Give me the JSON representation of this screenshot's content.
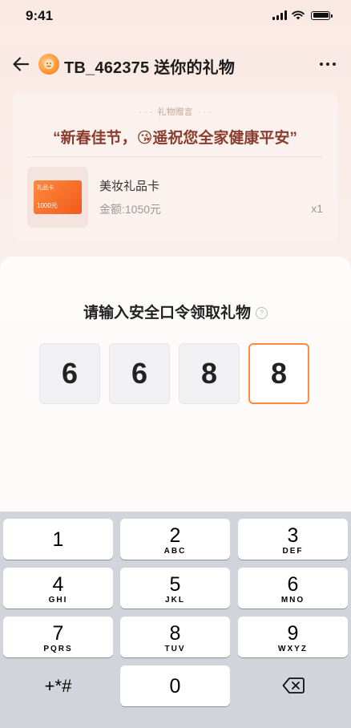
{
  "status": {
    "time": "9:41"
  },
  "header": {
    "title": "TB_462375 送你的礼物"
  },
  "gift": {
    "label": "礼物赠言",
    "message": "“新春佳节，😘遥祝您全家健康平安”",
    "card_label": "礼品卡",
    "card_amount": "1000元",
    "name": "美妆礼品卡",
    "amount": "金额:1050元",
    "qty": "x1"
  },
  "sheet": {
    "prompt": "请输入安全口令领取礼物",
    "help_symbol": "?",
    "code": [
      "6",
      "6",
      "8",
      "8"
    ]
  },
  "keypad": {
    "keys": [
      {
        "num": "1",
        "letters": ""
      },
      {
        "num": "2",
        "letters": "ABC"
      },
      {
        "num": "3",
        "letters": "DEF"
      },
      {
        "num": "4",
        "letters": "GHI"
      },
      {
        "num": "5",
        "letters": "JKL"
      },
      {
        "num": "6",
        "letters": "MNO"
      },
      {
        "num": "7",
        "letters": "PQRS"
      },
      {
        "num": "8",
        "letters": "TUV"
      },
      {
        "num": "9",
        "letters": "WXYZ"
      }
    ],
    "symbols": "+*#",
    "zero": "0"
  },
  "colors": {
    "accent": "#ff8a3d",
    "message": "#8a3d2e"
  }
}
